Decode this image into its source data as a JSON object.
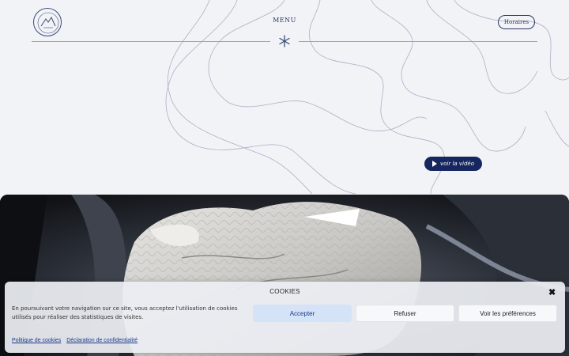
{
  "header": {
    "menu_label": "MENU",
    "hours_button": "Horaires"
  },
  "hero": {
    "video_button": "voir la vidéo"
  },
  "cookie_banner": {
    "title": "COOKIES",
    "close_symbol": "✖",
    "text": "En poursuivant votre navigation sur ce site, vous acceptez l'utilisation de cookies utilisés pour réaliser des statistiques de visites.",
    "accept_label": "Accepter",
    "refuse_label": "Refuser",
    "preferences_label": "Voir les préférences",
    "links": [
      "Politique de cookies",
      "Déclaration de confidentialité"
    ]
  },
  "colors": {
    "background": "#f2f3f6",
    "navy": "#16265e",
    "accept_bg": "#d4e3f7"
  },
  "icons": [
    "logo-mountain-icon",
    "asterisk-icon",
    "play-icon",
    "close-icon"
  ]
}
